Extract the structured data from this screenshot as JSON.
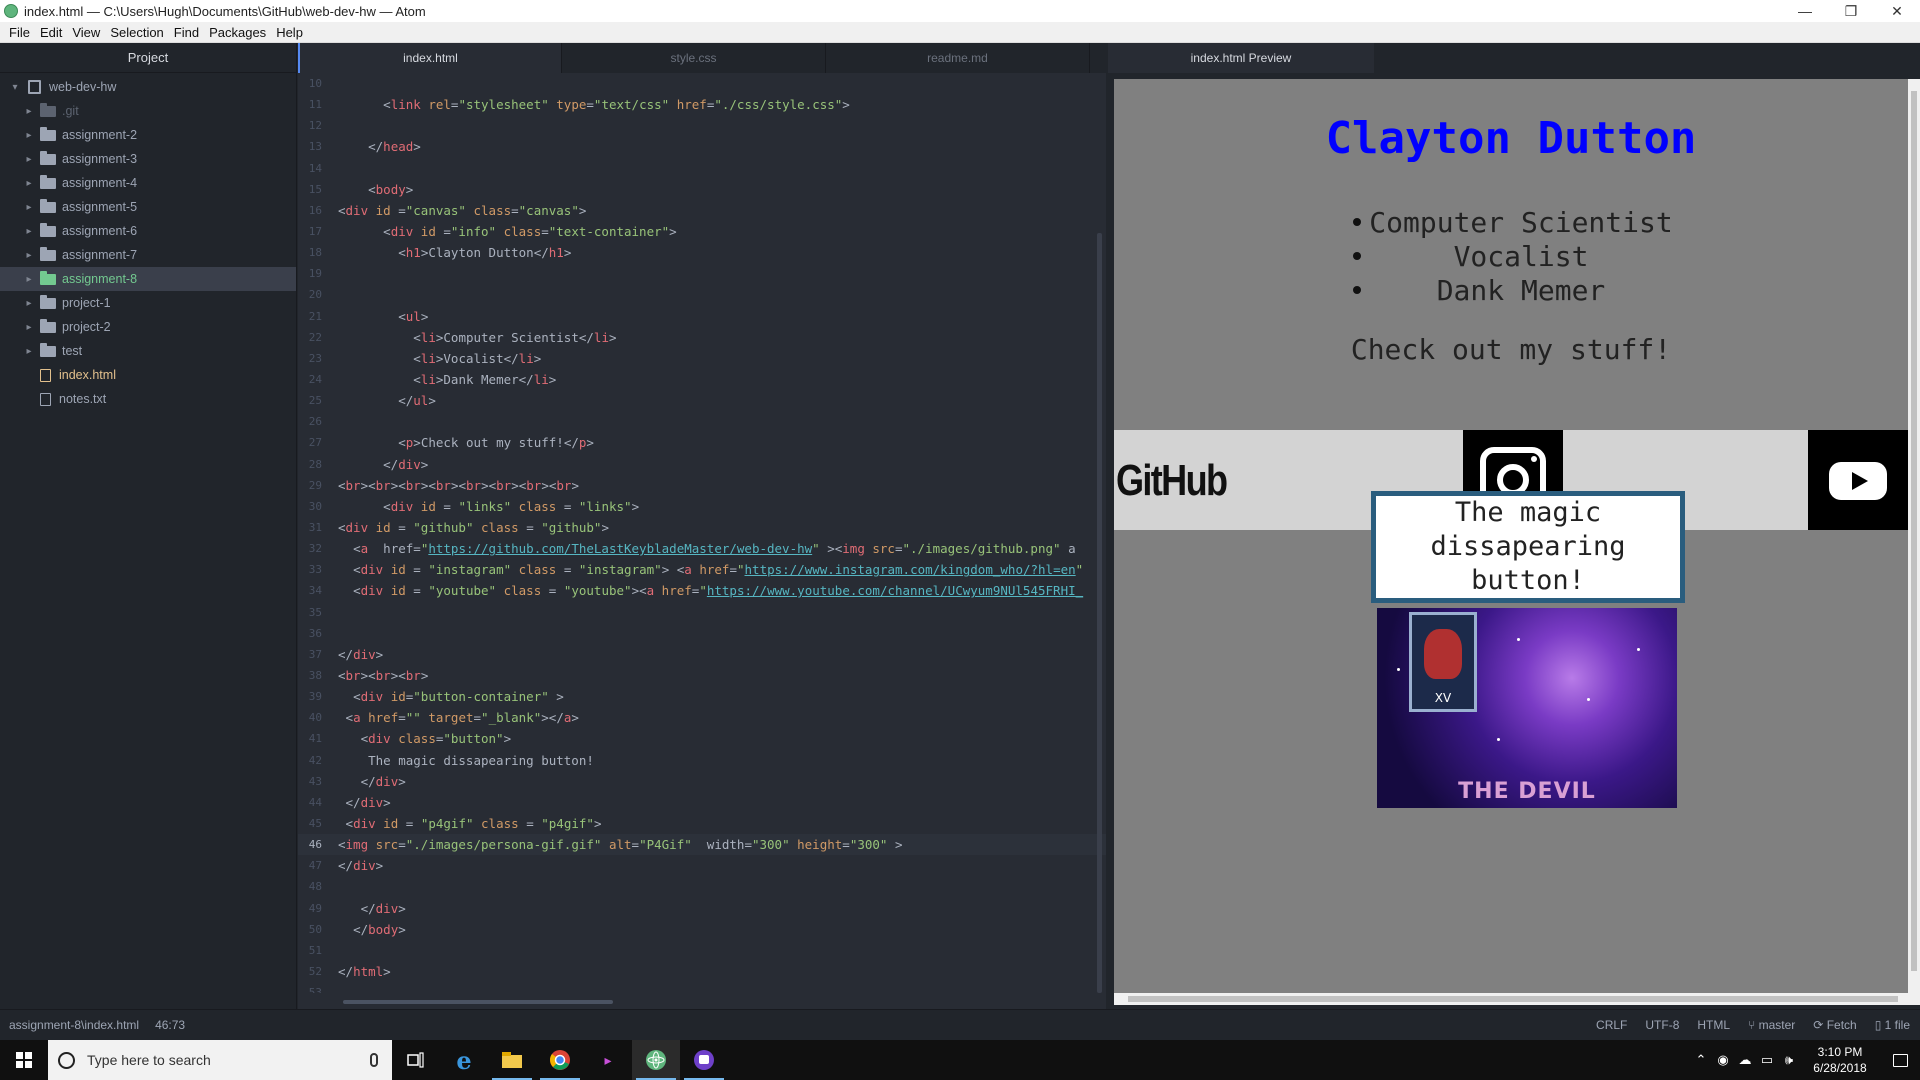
{
  "window": {
    "title": "index.html — C:\\Users\\Hugh\\Documents\\GitHub\\web-dev-hw — Atom",
    "controls": [
      "—",
      "❐",
      "✕"
    ]
  },
  "menu": [
    "File",
    "Edit",
    "View",
    "Selection",
    "Find",
    "Packages",
    "Help"
  ],
  "tree": {
    "header": "Project",
    "root": "web-dev-hw",
    "items": [
      {
        "label": ".git",
        "kind": "folder-git"
      },
      {
        "label": "assignment-2",
        "kind": "folder"
      },
      {
        "label": "assignment-3",
        "kind": "folder"
      },
      {
        "label": "assignment-4",
        "kind": "folder"
      },
      {
        "label": "assignment-5",
        "kind": "folder"
      },
      {
        "label": "assignment-6",
        "kind": "folder"
      },
      {
        "label": "assignment-7",
        "kind": "folder"
      },
      {
        "label": "assignment-8",
        "kind": "folder-selected"
      },
      {
        "label": "project-1",
        "kind": "folder"
      },
      {
        "label": "project-2",
        "kind": "folder"
      },
      {
        "label": "test",
        "kind": "folder"
      },
      {
        "label": "index.html",
        "kind": "file-modified"
      },
      {
        "label": "notes.txt",
        "kind": "file"
      }
    ]
  },
  "editor": {
    "tabs": [
      "index.html",
      "style.css",
      "readme.md"
    ],
    "active_tab": "index.html",
    "lines": [
      {
        "n": "10",
        "text": ""
      },
      {
        "n": "11",
        "text": "      <link rel=\"stylesheet\" type=\"text/css\" href=\"./css/style.css\">"
      },
      {
        "n": "12",
        "text": ""
      },
      {
        "n": "13",
        "text": "    </head>"
      },
      {
        "n": "14",
        "text": ""
      },
      {
        "n": "15",
        "text": "    <body>"
      },
      {
        "n": "16",
        "text": "<div id =\"canvas\" class=\"canvas\">"
      },
      {
        "n": "17",
        "text": "      <div id =\"info\" class=\"text-container\">"
      },
      {
        "n": "18",
        "text": "        <h1>Clayton Dutton</h1>"
      },
      {
        "n": "19",
        "text": ""
      },
      {
        "n": "20",
        "text": ""
      },
      {
        "n": "21",
        "text": "        <ul>"
      },
      {
        "n": "22",
        "text": "          <li>Computer Scientist</li>"
      },
      {
        "n": "23",
        "text": "          <li>Vocalist</li>"
      },
      {
        "n": "24",
        "text": "          <li>Dank Memer</li>"
      },
      {
        "n": "25",
        "text": "        </ul>"
      },
      {
        "n": "26",
        "text": ""
      },
      {
        "n": "27",
        "text": "        <p>Check out my stuff!</p>"
      },
      {
        "n": "28",
        "text": "      </div>"
      },
      {
        "n": "29",
        "text": "<br><br><br><br><br><br><br><br>"
      },
      {
        "n": "30",
        "text": "      <div id = \"links\" class = \"links\">"
      },
      {
        "n": "31",
        "text": "<div id = \"github\" class = \"github\">"
      },
      {
        "n": "32",
        "text": "  <a  href=\"https://github.com/TheLastKeybladeMaster/web-dev-hw\" ><img src=\"./images/github.png\" a"
      },
      {
        "n": "33",
        "text": "  <div id = \"instagram\" class = \"instagram\"> <a href=\"https://www.instagram.com/kingdom_who/?hl=en\""
      },
      {
        "n": "34",
        "text": "  <div id = \"youtube\" class = \"youtube\"><a href=\"https://www.youtube.com/channel/UCwyum9NUl545FRHI_"
      },
      {
        "n": "35",
        "text": ""
      },
      {
        "n": "36",
        "text": ""
      },
      {
        "n": "37",
        "text": "</div>"
      },
      {
        "n": "38",
        "text": "<br><br><br>"
      },
      {
        "n": "39",
        "text": "  <div id=\"button-container\" >"
      },
      {
        "n": "40",
        "text": " <a href=\"\" target=\"_blank\"></a>"
      },
      {
        "n": "41",
        "text": "   <div class=\"button\">"
      },
      {
        "n": "42",
        "text": "    The magic dissapearing button!"
      },
      {
        "n": "43",
        "text": "   </div>"
      },
      {
        "n": "44",
        "text": " </div>"
      },
      {
        "n": "45",
        "text": " <div id = \"p4gif\" class = \"p4gif\">"
      },
      {
        "n": "46",
        "text": "<img src=\"./images/persona-gif.gif\" alt=\"P4Gif\"  width=\"300\" height=\"300\" >"
      },
      {
        "n": "47",
        "text": "</div>"
      },
      {
        "n": "48",
        "text": ""
      },
      {
        "n": "49",
        "text": "   </div>"
      },
      {
        "n": "50",
        "text": "  </body>"
      },
      {
        "n": "51",
        "text": ""
      },
      {
        "n": "52",
        "text": "</html>"
      },
      {
        "n": "53",
        "text": ""
      }
    ],
    "cursor_line": "46"
  },
  "preview": {
    "tab": "index.html Preview",
    "name": "Clayton Dutton",
    "list": [
      "Computer Scientist",
      "Vocalist",
      "Dank Memer"
    ],
    "check": "Check out my stuff!",
    "github_logo": "GitHub",
    "button": "The magic dissapearing button!",
    "gif_card_numeral": "XV",
    "gif_caption": "THE DEVIL"
  },
  "status": {
    "path": "assignment-8\\index.html",
    "position": "46:73",
    "line_ending": "CRLF",
    "encoding": "UTF-8",
    "grammar": "HTML",
    "branch": "master",
    "fetch": "Fetch",
    "files": "1 file"
  },
  "taskbar": {
    "search_placeholder": "Type here to search",
    "time": "3:10 PM",
    "date": "6/28/2018"
  },
  "colors": {
    "preview_heading": "#0000ff",
    "selected_folder": "#73c990",
    "modified_file": "#e2c08d",
    "tag_red": "#e06c75"
  }
}
